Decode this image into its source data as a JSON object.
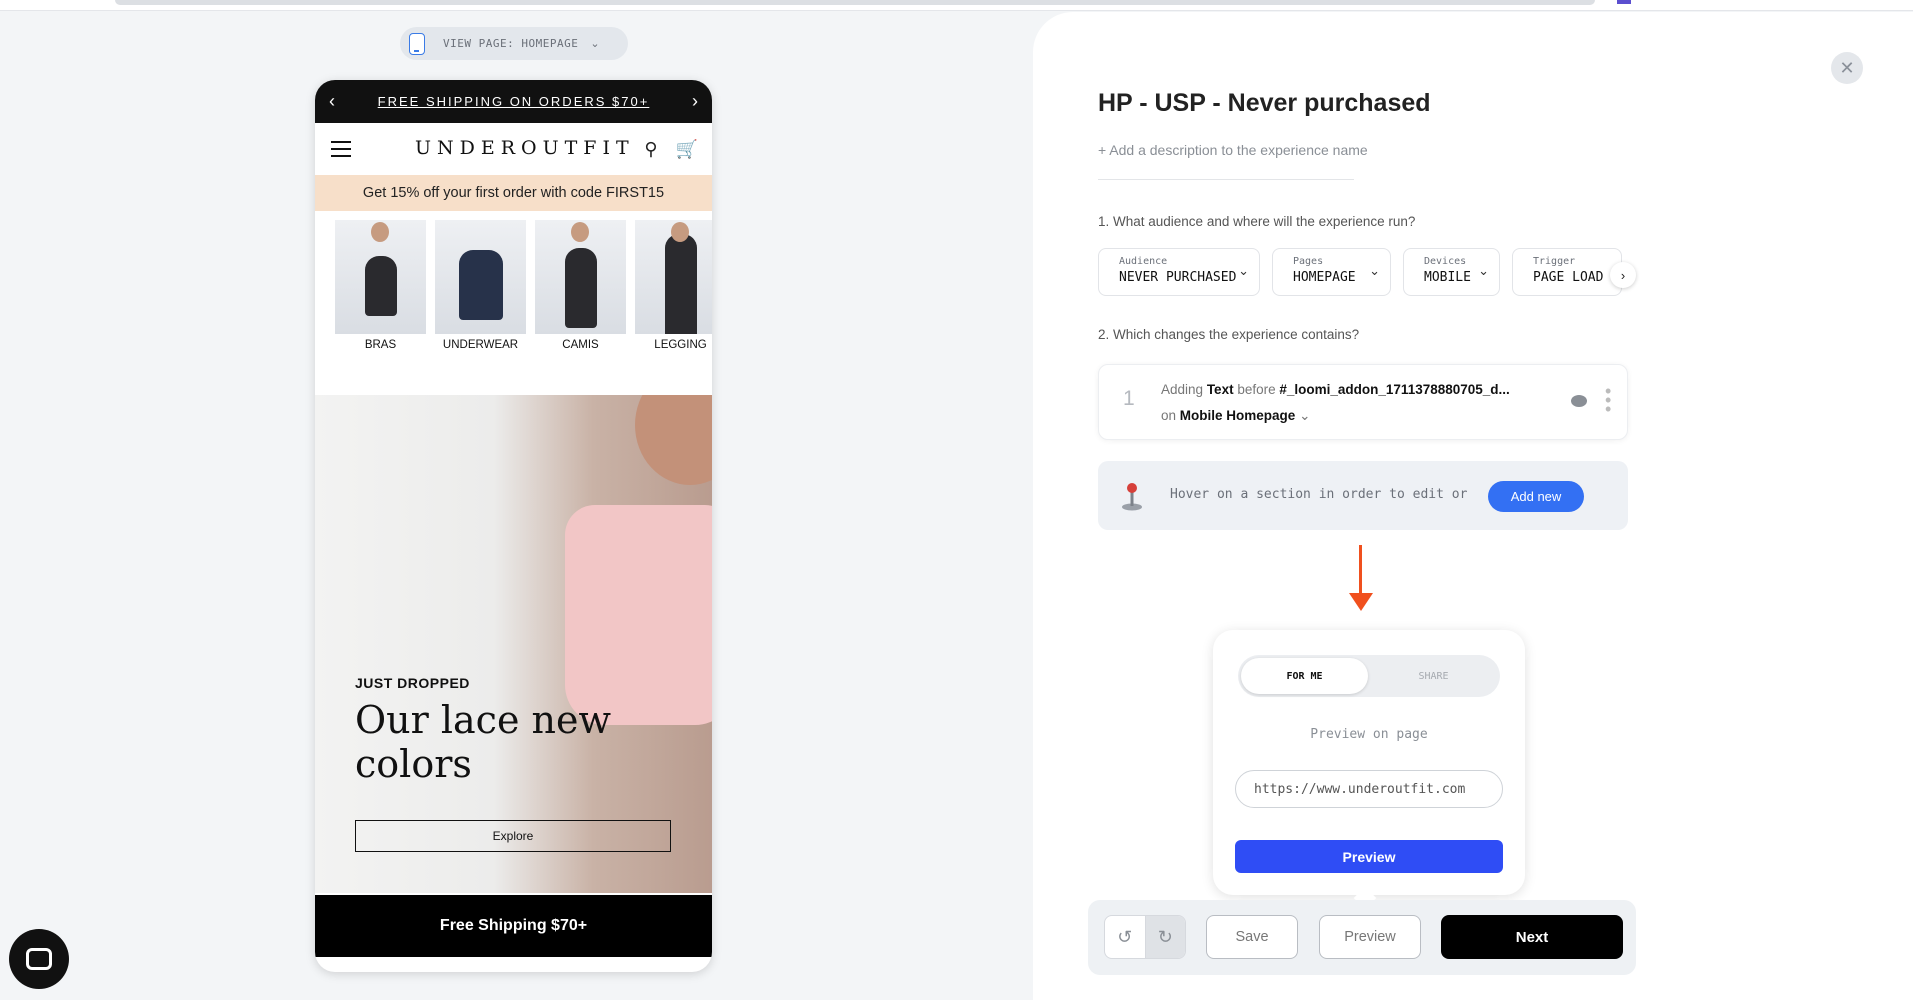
{
  "preview": {
    "view_page_label": "VIEW PAGE: HOMEPAGE",
    "announcement": "FREE SHIPPING ON ORDERS $70+",
    "logo": "UNDEROUTFIT",
    "promo": "Get 15% off your first order with code FIRST15",
    "categories": [
      {
        "label": "BRAS"
      },
      {
        "label": "UNDERWEAR"
      },
      {
        "label": "CAMIS"
      },
      {
        "label": "LEGGING"
      }
    ],
    "hero": {
      "kicker": "JUST DROPPED",
      "title": "Our lace new colors",
      "cta": "Explore"
    },
    "bottom_bar": "Free Shipping $70+"
  },
  "editor": {
    "title": "HP - USP - Never purchased",
    "description_placeholder": "+ Add a description to the experience name",
    "q1": "1. What audience and where will the experience run?",
    "targeting": [
      {
        "label": "Audience",
        "value": "NEVER PURCHASED"
      },
      {
        "label": "Pages",
        "value": "HOMEPAGE"
      },
      {
        "label": "Devices",
        "value": "MOBILE"
      },
      {
        "label": "Trigger",
        "value": "PAGE LOAD"
      }
    ],
    "q2": "2. Which changes the experience contains?",
    "change": {
      "number": "1",
      "action": "Adding",
      "type": "Text",
      "position": "before",
      "selector": "#_loomi_addon_1711378880705_d...",
      "on_label": "on",
      "page": "Mobile Homepage"
    },
    "hover_hint": "Hover on a section in order to edit or",
    "add_new": "Add new"
  },
  "preview_popover": {
    "tab_for_me": "FOR ME",
    "tab_share": "SHARE",
    "label": "Preview on page",
    "url_value": "https://www.underoutfit.com",
    "button": "Preview"
  },
  "toolbar": {
    "save": "Save",
    "preview": "Preview",
    "next": "Next"
  },
  "colors": {
    "accent_blue": "#2f4df5",
    "add_new_blue": "#3370f3",
    "arrow_orange": "#f0501e",
    "promo_bg": "#f7dfc9"
  }
}
